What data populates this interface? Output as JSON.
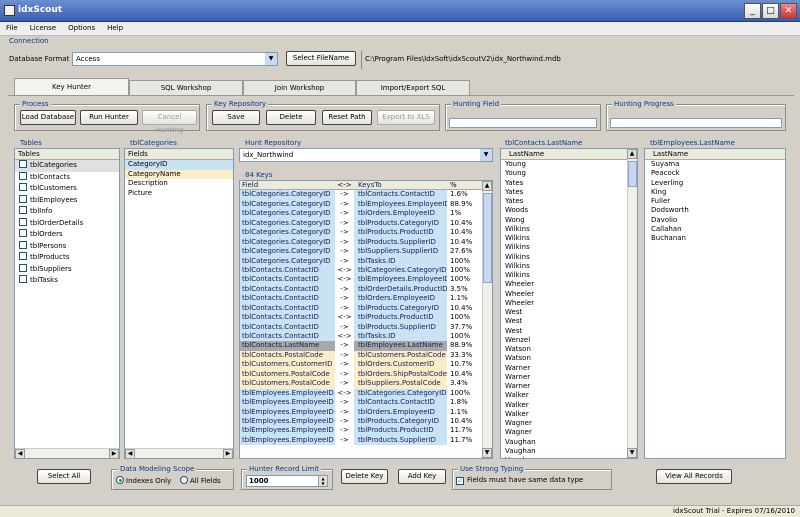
{
  "window": {
    "title": "idxScout"
  },
  "menu": [
    "File",
    "License",
    "Options",
    "Help"
  ],
  "connection": {
    "label": "Connection",
    "db_format_label": "Database Format",
    "db_format_value": "Access",
    "select_file_button": "Select FileName",
    "file_path": "C:\\Program Files\\IdxSoft\\idxScoutV2\\idx_Northwind.mdb"
  },
  "tabs": [
    "Key Hunter",
    "SQL Workshop",
    "Join Workshop",
    "Import/Export SQL"
  ],
  "process": {
    "label": "Process",
    "load": "Load Database",
    "run": "Run Hunter",
    "cancel": "Cancel Hunting"
  },
  "repo": {
    "label": "Key Repository",
    "save": "Save",
    "delete": "Delete",
    "reset": "Reset Path",
    "export": "Export to XLS"
  },
  "hunting_field": {
    "label": "Hunting Field"
  },
  "hunting_progress": {
    "label": "Hunting Progress"
  },
  "tables": {
    "label": "Tables",
    "header": "Tables",
    "items": [
      "tblCategories",
      "tblContacts",
      "tblCustomers",
      "tblEmployees",
      "tblInfo",
      "tblOrderDetails",
      "tblOrders",
      "tblPersons",
      "tblProducts",
      "tblSuppliers",
      "tblTasks"
    ]
  },
  "fields": {
    "label": "tblCategories",
    "header": "Fields",
    "items": [
      "CategoryID",
      "CategoryName",
      "Description",
      "Picture"
    ]
  },
  "hunt_repo": {
    "label": "Hunt Repository",
    "value": "idx_Northwind"
  },
  "keys": {
    "label": "84 Keys",
    "headers": [
      "Field",
      "<->",
      "KeysTo",
      "%"
    ],
    "rows": [
      [
        "tblCategories.CategoryID",
        "->",
        "tblContacts.ContactID",
        "1.6%"
      ],
      [
        "tblCategories.CategoryID",
        "->",
        "tblEmployees.EmployeeID",
        "88.9%"
      ],
      [
        "tblCategories.CategoryID",
        "->",
        "tblOrders.EmployeeID",
        "1%"
      ],
      [
        "tblCategories.CategoryID",
        "->",
        "tblProducts.CategoryID",
        "10.4%"
      ],
      [
        "tblCategories.CategoryID",
        "->",
        "tblProducts.ProductID",
        "10.4%"
      ],
      [
        "tblCategories.CategoryID",
        "->",
        "tblProducts.SupplierID",
        "10.4%"
      ],
      [
        "tblCategories.CategoryID",
        "->",
        "tblSuppliers.SupplierID",
        "27.6%"
      ],
      [
        "tblCategories.CategoryID",
        "->",
        "tblTasks.ID",
        "100%"
      ],
      [
        "tblContacts.ContactID",
        "<->",
        "tblCategories.CategoryID",
        "100%"
      ],
      [
        "tblContacts.ContactID",
        "<->",
        "tblEmployees.EmployeeID",
        "100%"
      ],
      [
        "tblContacts.ContactID",
        "->",
        "tblOrderDetails.ProductID",
        "3.5%"
      ],
      [
        "tblContacts.ContactID",
        "->",
        "tblOrders.EmployeeID",
        "1.1%"
      ],
      [
        "tblContacts.ContactID",
        "->",
        "tblProducts.CategoryID",
        "10.4%"
      ],
      [
        "tblContacts.ContactID",
        "<->",
        "tblProducts.ProductID",
        "100%"
      ],
      [
        "tblContacts.ContactID",
        "->",
        "tblProducts.SupplierID",
        "37.7%"
      ],
      [
        "tblContacts.ContactID",
        "<->",
        "tblTasks.ID",
        "100%"
      ],
      [
        "tblContacts.LastName",
        "->",
        "tblEmployees.LastName",
        "88.9%"
      ],
      [
        "tblContacts.PostalCode",
        "->",
        "tblCustomers.PostalCode",
        "33.3%"
      ],
      [
        "tblCustomers.CustomerID",
        "->",
        "tblOrders.CustomerID",
        "10.7%"
      ],
      [
        "tblCustomers.PostalCode",
        "->",
        "tblOrders.ShipPostalCode",
        "10.4%"
      ],
      [
        "tblCustomers.PostalCode",
        "->",
        "tblSuppliers.PostalCode",
        "3.4%"
      ],
      [
        "tblEmployees.EmployeeID",
        "<->",
        "tblCategories.CategoryID",
        "100%"
      ],
      [
        "tblEmployees.EmployeeID",
        "->",
        "tblContacts.ContactID",
        "1.8%"
      ],
      [
        "tblEmployees.EmployeeID",
        "->",
        "tblOrders.EmployeeID",
        "1.1%"
      ],
      [
        "tblEmployees.EmployeeID",
        "->",
        "tblProducts.CategoryID",
        "10.4%"
      ],
      [
        "tblEmployees.EmployeeID",
        "->",
        "tblProducts.ProductID",
        "11.7%"
      ],
      [
        "tblEmployees.EmployeeID",
        "->",
        "tblProducts.SupplierID",
        "11.7%"
      ]
    ]
  },
  "contacts_lastname": {
    "label": "tblContacts.LastName",
    "header": "LastName",
    "items": [
      "Young",
      "Young",
      "Yates",
      "Yates",
      "Yates",
      "Woods",
      "Wong",
      "Wilkins",
      "Wilkins",
      "Wilkins",
      "Wilkins",
      "Wilkins",
      "Wilkins",
      "Wheeler",
      "Wheeler",
      "Wheeler",
      "West",
      "West",
      "West",
      "Wenzel",
      "Watson",
      "Watson",
      "Warner",
      "Warner",
      "Warner",
      "Walker",
      "Walker",
      "Walker",
      "Wagner",
      "Wagner",
      "Vaughan",
      "Vaughan",
      "Vaughan"
    ]
  },
  "employees_lastname": {
    "label": "tblEmployees.LastName",
    "header": "LastName",
    "items": [
      "Suyama",
      "Peacock",
      "Leverling",
      "King",
      "Fuller",
      "Dodsworth",
      "Davolio",
      "Callahan",
      "Buchanan"
    ]
  },
  "bottom": {
    "select_all": "Select All",
    "scope_label": "Data Modeling Scope",
    "scope_indexes": "Indexes Only",
    "scope_all": "All Fields",
    "limit_label": "Hunter Record Limit",
    "limit_value": "1000",
    "delete_key": "Delete Key",
    "add_key": "Add Key",
    "strong_label": "Use Strong Typing",
    "strong_text": "Fields must have same data type",
    "view_all": "View All Records"
  },
  "status": "idxScout Trial - Expires 07/16/2010",
  "colors": {
    "key_link": "#c7e3f4",
    "key_alt": "#fbeec6",
    "selected": "#a8a8a8",
    "title_bar": "#3a5fb0"
  }
}
